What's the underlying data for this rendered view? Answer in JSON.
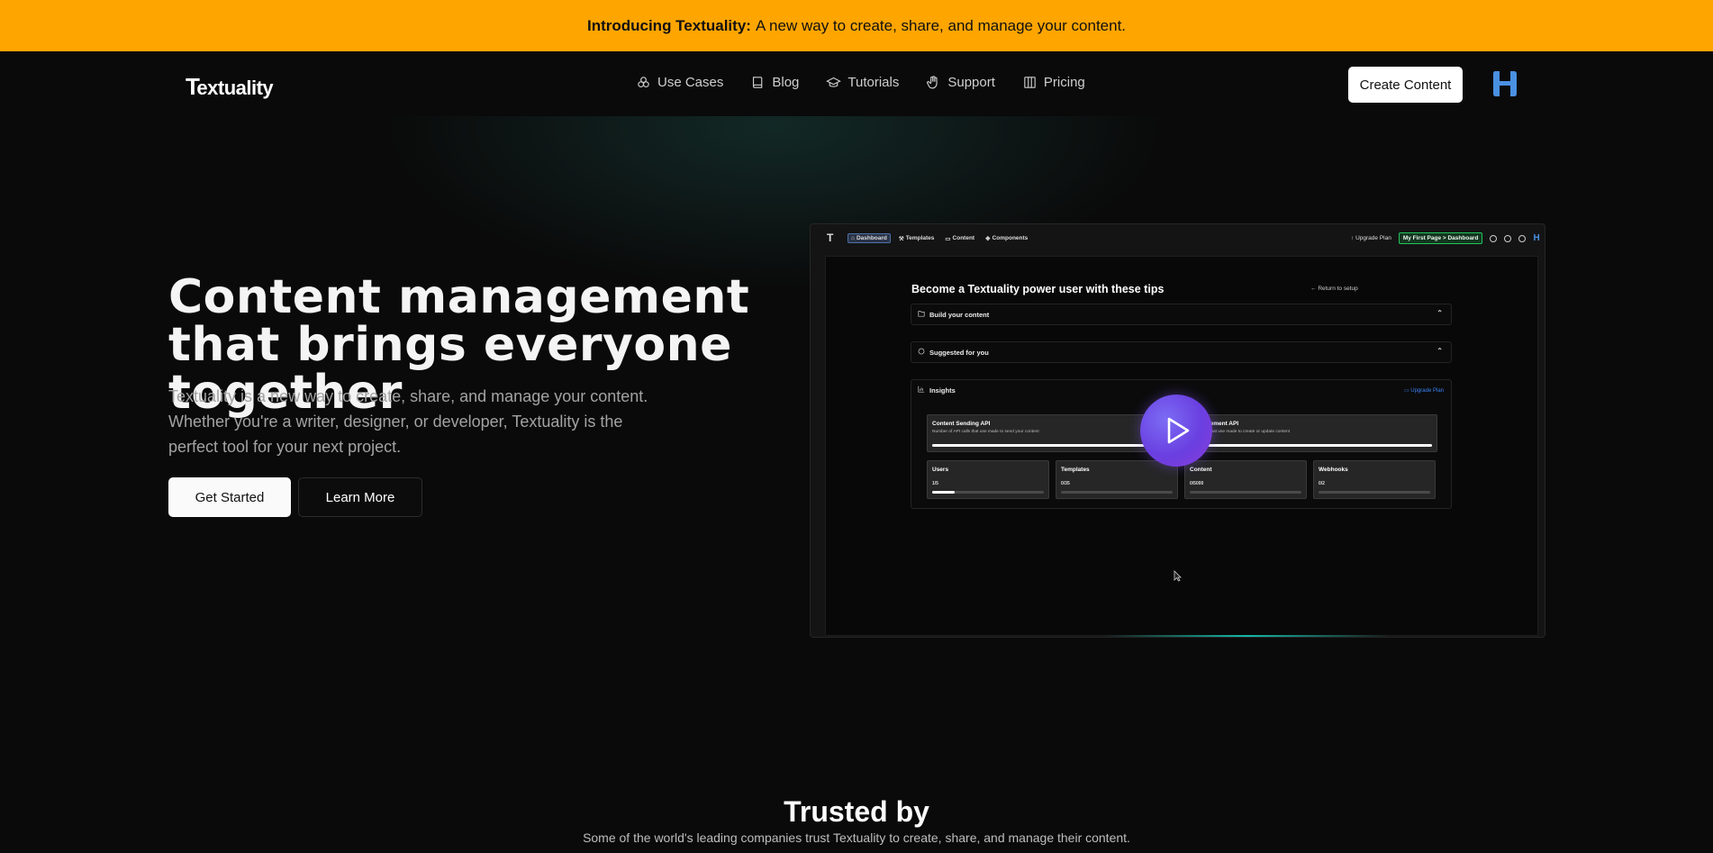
{
  "banner": {
    "strong": "Introducing Textuality:",
    "text": "A new way to create, share, and manage your content.",
    "background": "#ffa500"
  },
  "nav": {
    "logo": "Textuality",
    "items": [
      {
        "label": "Use Cases",
        "icon": "cubes-icon"
      },
      {
        "label": "Blog",
        "icon": "book-icon"
      },
      {
        "label": "Tutorials",
        "icon": "graduation-cap-icon"
      },
      {
        "label": "Support",
        "icon": "hand-icon"
      },
      {
        "label": "Pricing",
        "icon": "columns-icon"
      }
    ],
    "cta": "Create Content",
    "brand_icon": "h-brand-icon",
    "brand_color": "#4a90e2"
  },
  "hero": {
    "title": "Content management that brings everyone together",
    "subtitle": "Textuality is a new way to create, share, and manage your content. Whether you're a writer, designer, or developer, Textuality is the perfect tool for your next project.",
    "primary_button": "Get Started",
    "secondary_button": "Learn More"
  },
  "preview": {
    "logo": "T",
    "tabs": [
      {
        "label": "Dashboard",
        "active": true
      },
      {
        "label": "Templates",
        "active": false
      },
      {
        "label": "Content",
        "active": false
      },
      {
        "label": "Components",
        "active": false
      }
    ],
    "upgrade": "Upgrade Plan",
    "breadcrumb_chip": "My First Page > Dashboard",
    "heading": "Become a Textuality power user with these tips",
    "return_link": "Return to setup",
    "accordions": [
      "Build your content",
      "Suggested for you"
    ],
    "insights": {
      "title": "Insights",
      "upgrade": "Upgrade Plan",
      "api_cards": [
        {
          "title": "Content Sending API",
          "desc": "Number of API calls that use made to send your content"
        },
        {
          "title": "Management API",
          "desc": "API calls that use made to create or update content"
        }
      ],
      "stat_cards": [
        {
          "title": "Users",
          "value": "1/5",
          "progress": 0.2
        },
        {
          "title": "Templates",
          "value": "0/35",
          "progress": 0
        },
        {
          "title": "Content",
          "value": "0/5000",
          "progress": 0
        },
        {
          "title": "Webhooks",
          "value": "0/2",
          "progress": 0
        }
      ]
    },
    "play_color": "#6a4be6",
    "accent_glow": "#14b8a6"
  },
  "trusted": {
    "title": "Trusted by",
    "subtitle": "Some of the world's leading companies trust Textuality to create, share, and manage their content."
  }
}
